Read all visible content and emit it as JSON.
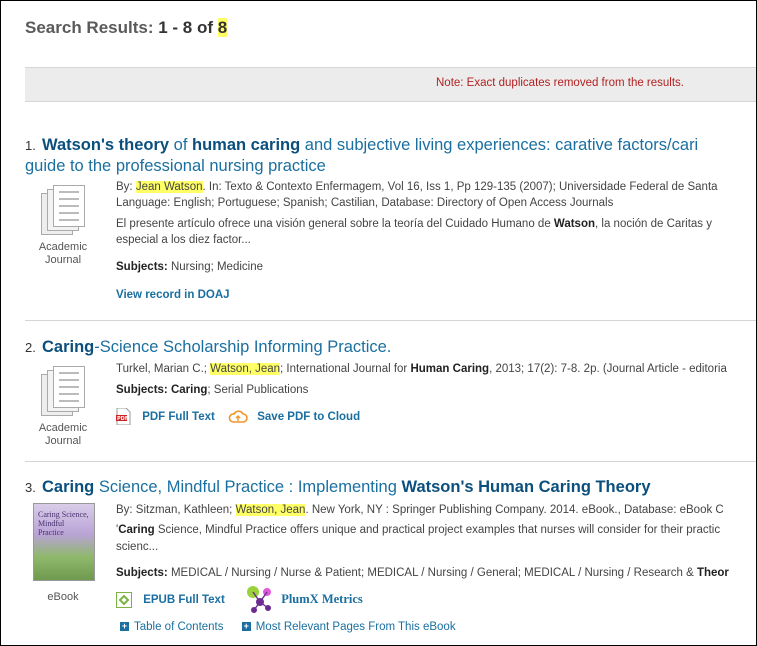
{
  "header": {
    "prefix": "Search Results: ",
    "range": "1 - 8 of ",
    "total": "8"
  },
  "note": "Note: Exact duplicates removed from the results.",
  "results": [
    {
      "number": "1.",
      "title_line1_a": "Watson's theory",
      "title_line1_b": " of ",
      "title_line1_c": "human caring",
      "title_line1_d": " and subjective living experiences: carative factors/cari",
      "title_line2": "guide to the professional nursing practice",
      "type": "Academic Journal",
      "by_label": "By: ",
      "author": "Jean Watson",
      "source": ". In: Texto & Contexto Enfermagem, Vol 16, Iss 1, Pp 129-135 (2007); Universidade Federal de Santa",
      "language": "Language: English; Portuguese; Spanish; Castilian, Database: Directory of Open Access Journals",
      "abstract_a": "El presente artículo ofrece una visión general sobre la teoría del Cuidado Humano de ",
      "abstract_b": "Watson",
      "abstract_c": ", la noción de Caritas y",
      "abstract_line2": "especial a los diez factor...",
      "subjects_label": "Subjects:",
      "subjects": " Nursing; Medicine",
      "link": "View record in DOAJ"
    },
    {
      "number": "2.",
      "title_a": "Caring",
      "title_b": "-Science Scholarship Informing Practice.",
      "type": "Academic Journal",
      "author_pre": "Turkel, Marian C.; ",
      "author": "Watson, Jean",
      "source_a": "; International Journal for ",
      "source_b": "Human Caring",
      "source_c": ", 2013; 17(2): 7-8. 2p. (Journal Article - editoria",
      "subjects_label": "Subjects:",
      "subjects_bold": " Caring",
      "subjects": "; Serial Publications",
      "pdf_link": "PDF Full Text",
      "cloud_link": "Save PDF to Cloud"
    },
    {
      "number": "3.",
      "title_a": "Caring",
      "title_b": " Science, Mindful Practice : Implementing ",
      "title_c": "Watson's Human Caring Theory",
      "type": "eBook",
      "cover_text": "Caring Science, Mindful Practice",
      "by_label": "By: Sitzman, Kathleen; ",
      "author": "Watson, Jean",
      "source": ". New York, NY : Springer Publishing Company. 2014. eBook., Database: eBook C",
      "abstract_a": "'",
      "abstract_b": "Caring",
      "abstract_c": " Science, Mindful Practice offers unique and practical project examples that nurses will consider for their practic",
      "abstract_line2": "scienc...",
      "subjects_label": "Subjects:",
      "subjects": " MEDICAL / Nursing / Nurse & Patient; MEDICAL / Nursing / General; MEDICAL / Nursing / Research & ",
      "subjects_bold": "Theor",
      "epub_link": "EPUB Full Text",
      "plumx_link": "PlumX Metrics",
      "toc_link": "Table of Contents",
      "relevant_link": "Most Relevant Pages From This eBook"
    }
  ]
}
